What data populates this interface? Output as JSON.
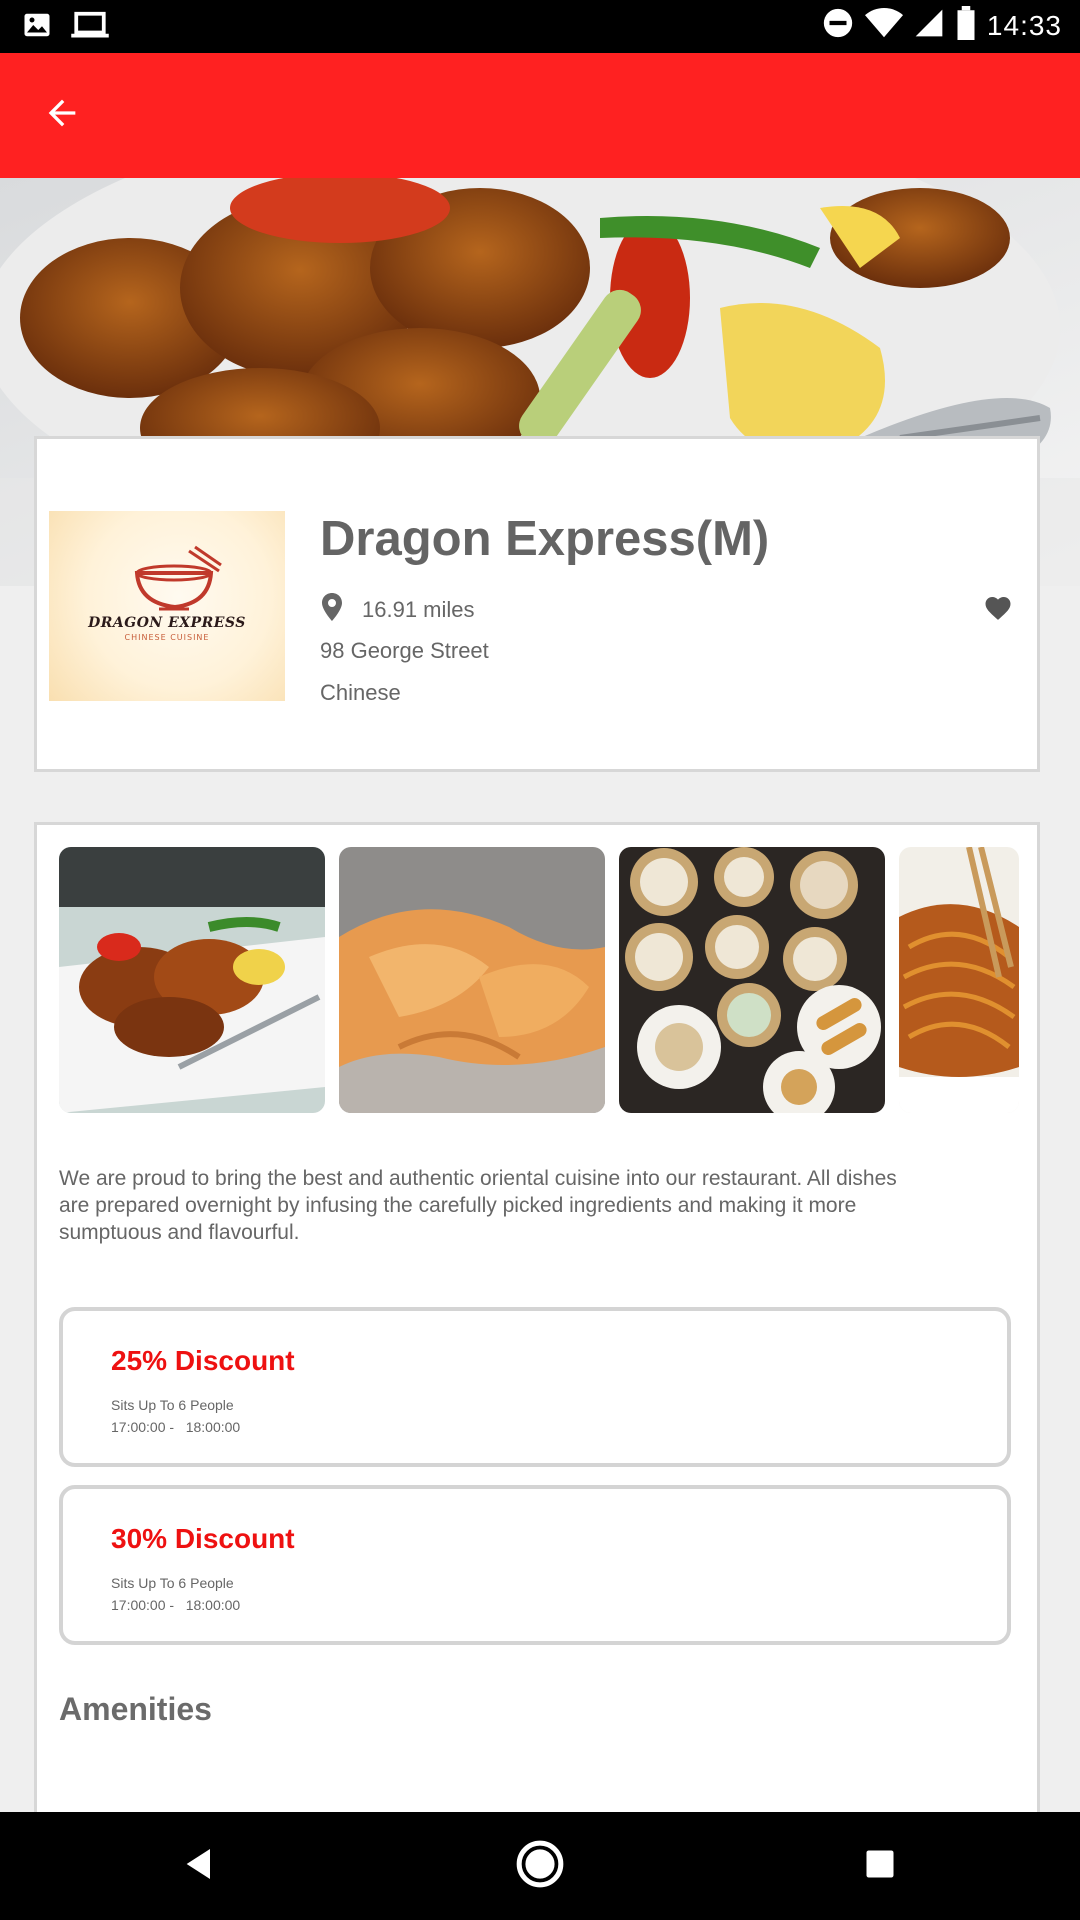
{
  "status_bar": {
    "time": "14:33",
    "icons": [
      "image-icon",
      "laptop-icon",
      "do-not-disturb-icon",
      "wifi-icon",
      "signal-icon",
      "battery-icon"
    ]
  },
  "app_bar": {
    "back_icon": "arrow-back-icon",
    "color": "#ff2121"
  },
  "restaurant": {
    "name": "Dragon Express(M)",
    "distance": "16.91 miles",
    "address": "98 George Street",
    "cuisine": "Chinese",
    "logo_text": "DRAGON EXPRESS",
    "logo_subtext": "CHINESE CUISINE",
    "favorite_icon": "heart-icon"
  },
  "gallery": {
    "photos": [
      "sweet-and-sour-pork",
      "fried-wontons",
      "dim-sum-table",
      "noodles-with-chopsticks"
    ]
  },
  "description": "We are proud to bring the best and authentic oriental cuisine into our restaurant. All dishes are prepared overnight by infusing the carefully picked ingredients and making it more sumptuous and flavourful.",
  "offers": [
    {
      "title": "25% Discount",
      "seats": "Sits Up To 6 People",
      "time": "17:00:00 -   18:00:00"
    },
    {
      "title": "30% Discount",
      "seats": "Sits Up To 6 People",
      "time": "17:00:00 -   18:00:00"
    }
  ],
  "amenities_heading": "Amenities",
  "colors": {
    "accent": "#ff2121",
    "offer_title": "#ee1111",
    "text": "#666666"
  },
  "nav_bar": {
    "icons": [
      "back-triangle-icon",
      "home-circle-icon",
      "recents-square-icon"
    ]
  }
}
